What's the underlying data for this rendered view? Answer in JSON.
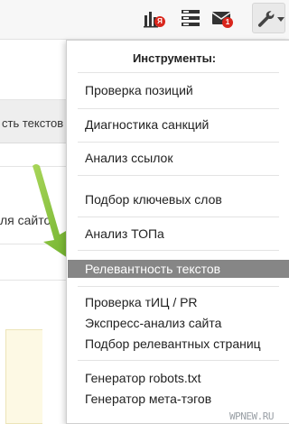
{
  "toolbar": {
    "icons": [
      {
        "name": "stats-icon",
        "badge": "Я"
      },
      {
        "name": "list-icon"
      },
      {
        "name": "mail-icon",
        "badge": "1"
      }
    ],
    "tools_icon": "wrench-icon",
    "badge_color": "#d9261c"
  },
  "background": {
    "tab_text": "сть текстов",
    "line_text": "ля сайто"
  },
  "menu": {
    "header": "Инструменты:",
    "groups": [
      {
        "items": [
          "Проверка позиций"
        ]
      },
      {
        "items": [
          "Диагностика санкций"
        ]
      },
      {
        "items": [
          "Анализ ссылок"
        ]
      },
      {
        "items": [
          "Подбор ключевых слов"
        ]
      },
      {
        "items": [
          "Анализ ТОПа"
        ]
      },
      {
        "items": [
          "Релевантность текстов"
        ],
        "active": true
      },
      {
        "items": [
          "Проверка тИЦ / PR",
          "Экспресс-анализ сайта",
          "Подбор релевантных страниц"
        ]
      },
      {
        "items": [
          "Генератор robots.txt",
          "Генератор мета-тэгов"
        ]
      }
    ],
    "active_color": "#868686"
  },
  "arrow_color": "#8fc63f",
  "watermark": "WPNEW.RU"
}
